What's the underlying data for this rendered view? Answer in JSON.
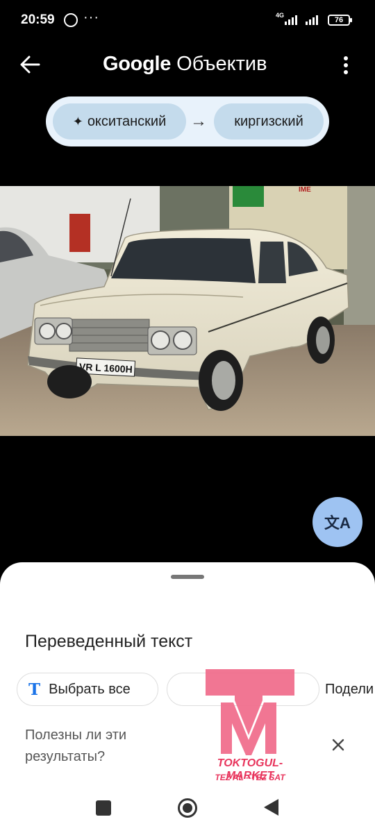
{
  "status_bar": {
    "time": "20:59",
    "more": "···",
    "network": "4G",
    "battery": "76"
  },
  "app_bar": {
    "title_brand": "Google",
    "title_product": "Объектив"
  },
  "languages": {
    "source": "окситанский",
    "target": "киргизский"
  },
  "sheet": {
    "title": "Переведенный текст",
    "select_all": "Выбрать все",
    "share": "Подели",
    "feedback_line1": "Полезны ли эти",
    "feedback_line2": "результаты?"
  },
  "photo": {
    "plate": "VR L 1600H",
    "banner": "IME"
  },
  "watermark": {
    "letter": "T",
    "line1": "TOKTOGUL- MARKET",
    "line2": "TEZ AL - TEZ SAT"
  }
}
